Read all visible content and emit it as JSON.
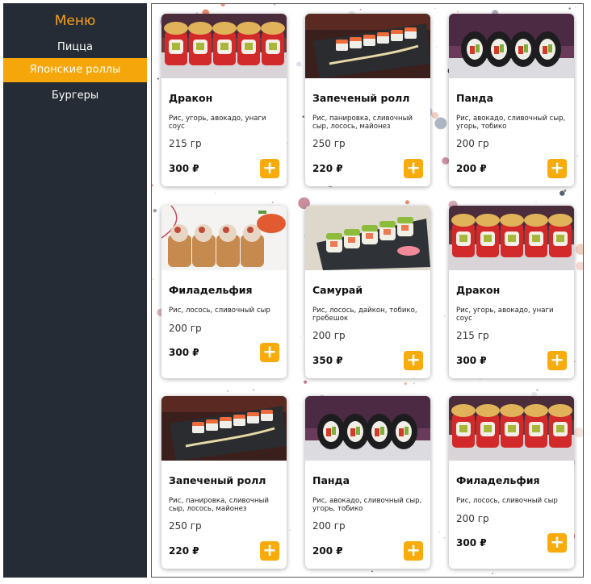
{
  "sidebar": {
    "title": "Меню",
    "items": [
      {
        "label": "Пицца",
        "active": false
      },
      {
        "label": "Японские роллы",
        "active": true
      },
      {
        "label": "Бургеры",
        "active": false
      }
    ]
  },
  "colors": {
    "sidebar_bg": "#252c36",
    "accent": "#f5a60a",
    "title": "#f5a01a",
    "add_button": "#f8ab0b"
  },
  "products": [
    {
      "name": "Дракон",
      "desc": "Рис, угорь, авокадо, унаги соус",
      "weight": "215 гр",
      "price": "300 ₽",
      "image": "dragon-roll"
    },
    {
      "name": "Запеченый ролл",
      "desc": "Рис, панировка, сливочный сыр, лосось, майонез",
      "weight": "250 гр",
      "price": "220 ₽",
      "image": "baked-roll"
    },
    {
      "name": "Панда",
      "desc": "Рис, авокадо, сливочный сыр, угорь, тобико",
      "weight": "200 гр",
      "price": "200 ₽",
      "image": "panda-roll"
    },
    {
      "name": "Филадельфия",
      "desc": "Рис, лосось, сливочный сыр",
      "weight": "200 гр",
      "price": "300 ₽",
      "image": "tempura-roll"
    },
    {
      "name": "Самурай",
      "desc": "Рис, лосось, дайкон, тобико, гребешок",
      "weight": "200 гр",
      "price": "350 ₽",
      "image": "samurai-roll"
    },
    {
      "name": "Дракон",
      "desc": "Рис, угорь, авокадо, унаги соус",
      "weight": "215 гр",
      "price": "300 ₽",
      "image": "dragon-roll"
    },
    {
      "name": "Запеченый ролл",
      "desc": "Рис, панировка, сливочный сыр, лосось, майонез",
      "weight": "250 гр",
      "price": "220 ₽",
      "image": "baked-roll"
    },
    {
      "name": "Панда",
      "desc": "Рис, авокадо, сливочный сыр, угорь, тобико",
      "weight": "200 гр",
      "price": "200 ₽",
      "image": "panda-roll"
    },
    {
      "name": "Филадельфия",
      "desc": "Рис, лосось, сливочный сыр",
      "weight": "200 гр",
      "price": "300 ₽",
      "image": "dragon-roll"
    }
  ],
  "add_label": "+"
}
